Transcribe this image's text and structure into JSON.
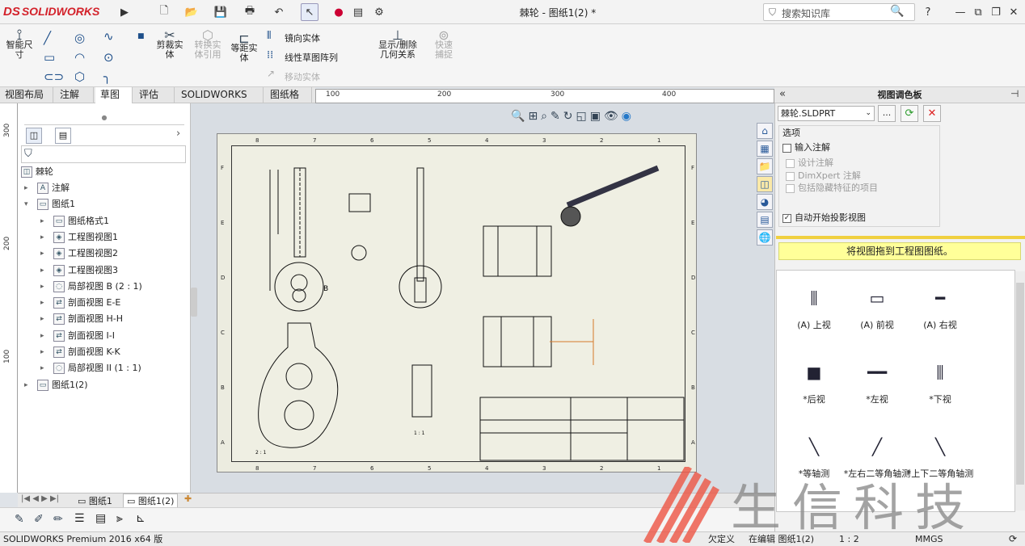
{
  "app": {
    "logo_prefix": "DS",
    "logo_text": "SOLIDWORKS",
    "window_title": "棘轮 - 图纸1(2) *"
  },
  "search": {
    "placeholder": "搜索知识库"
  },
  "ribbon": {
    "smart_dim": "智能尺寸",
    "trim": "剪裁实体",
    "convert": "转换实体引用",
    "offset": "等距实体",
    "mirror": "镜向实体",
    "linear_pattern": "线性草图阵列",
    "move": "移动实体",
    "show_delete": "显示/删除几何关系",
    "quick_snap": "快速捕捉"
  },
  "tabs": [
    "视图布局",
    "注解",
    "草图",
    "评估",
    "SOLIDWORKS 插件",
    "图纸格式"
  ],
  "active_tab": "草图",
  "ruler": {
    "h": [
      "100",
      "200",
      "300",
      "400"
    ],
    "v": [
      "300",
      "200",
      "100"
    ]
  },
  "tree": {
    "root": "棘轮",
    "items": [
      {
        "label": "注解",
        "indent": 1,
        "icon": "A"
      },
      {
        "label": "图纸1",
        "indent": 1,
        "icon": "▭",
        "expanded": true
      },
      {
        "label": "图纸格式1",
        "indent": 2,
        "icon": "▭"
      },
      {
        "label": "工程图视图1",
        "indent": 2,
        "icon": "◈"
      },
      {
        "label": "工程图视图2",
        "indent": 2,
        "icon": "◈"
      },
      {
        "label": "工程图视图3",
        "indent": 2,
        "icon": "◈"
      },
      {
        "label": "局部视图 B (2 : 1)",
        "indent": 2,
        "icon": "◌"
      },
      {
        "label": "剖面视图 E-E",
        "indent": 2,
        "icon": "⇄"
      },
      {
        "label": "剖面视图 H-H",
        "indent": 2,
        "icon": "⇄"
      },
      {
        "label": "剖面视图 I-I",
        "indent": 2,
        "icon": "⇄"
      },
      {
        "label": "剖面视图 K-K",
        "indent": 2,
        "icon": "⇄"
      },
      {
        "label": "局部视图 II (1 : 1)",
        "indent": 2,
        "icon": "◌"
      },
      {
        "label": "图纸1(2)",
        "indent": 1,
        "icon": "▭"
      }
    ]
  },
  "drawing": {
    "col_labels": [
      "8",
      "7",
      "6",
      "5",
      "4",
      "3",
      "2",
      "1"
    ],
    "row_labels": [
      "F",
      "E",
      "D",
      "C",
      "B",
      "A"
    ],
    "view_label_b": "B",
    "scale_21": "2 : 1",
    "scale_11": "1 : 1"
  },
  "sheet_tabs": [
    "图纸1",
    "图纸1(2)"
  ],
  "view_palette": {
    "title": "视图调色板",
    "file": "棘轮.SLDPRT",
    "options_label": "选项",
    "import_annotations": "输入注解",
    "design_annotations": "设计注解",
    "dimxpert": "DimXpert 注解",
    "hidden_features": "包括隐藏特征的项目",
    "auto_projection": "自动开始投影视图",
    "hint": "将视图拖到工程图图纸。",
    "views": [
      "(A) 上视",
      "(A) 前视",
      "(A) 右视",
      "*后视",
      "*左视",
      "*下视",
      "*等轴测",
      "*左右二等角轴测",
      "*上下二等角轴测"
    ]
  },
  "status": {
    "version": "SOLIDWORKS Premium 2016 x64 版",
    "underdefined": "欠定义",
    "editing": "在编辑 图纸1(2)",
    "scale": "1 : 2",
    "units": "MMGS"
  },
  "watermark": {
    "text": "生信科技"
  }
}
